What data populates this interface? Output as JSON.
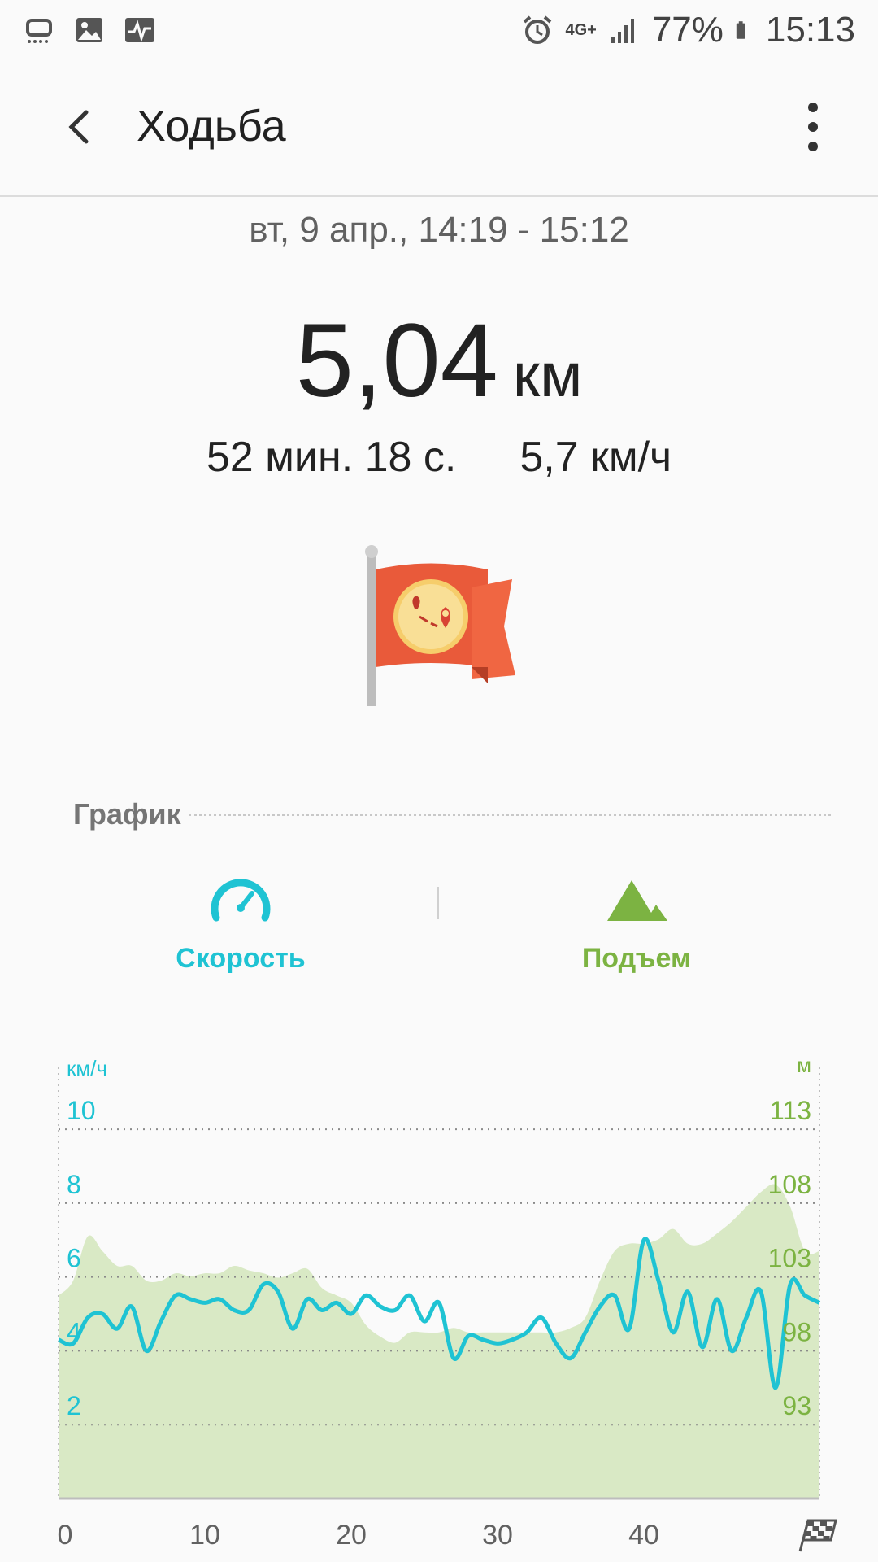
{
  "status_bar": {
    "battery": "77%",
    "time": "15:13",
    "network": "4G+",
    "icons": [
      "notification-icon",
      "gallery-icon",
      "activity-icon",
      "alarm-icon",
      "signal-icon",
      "battery-icon"
    ]
  },
  "appbar": {
    "title": "Ходьба",
    "back_icon": "back-arrow-icon",
    "menu_icon": "more-vert-icon"
  },
  "workout": {
    "date": "вт, 9 апр., 14:19 - 15:12",
    "distance_value": "5,04",
    "distance_unit": "км",
    "duration": "52 мин. 18 с.",
    "avg_speed": "5,7 км/ч",
    "badge_icon": "route-flag-icon"
  },
  "graph": {
    "section_title": "График",
    "tabs": [
      {
        "label": "Скорость",
        "icon": "speedometer-icon",
        "color": "#1fc3d3"
      },
      {
        "label": "Подъем",
        "icon": "mountain-icon",
        "color": "#7cb342"
      }
    ]
  },
  "chart_data": {
    "type": "line",
    "left_axis_unit": "км/ч",
    "right_axis_unit": "м",
    "left_ticks": [
      "10",
      "8",
      "6",
      "4",
      "2"
    ],
    "right_ticks": [
      "113",
      "108",
      "103",
      "98",
      "93"
    ],
    "x_ticks": [
      "0",
      "10",
      "20",
      "30",
      "40"
    ],
    "finish_icon": "checkered-flag-icon",
    "xlim": [
      0,
      52
    ],
    "y_left_lim": [
      0,
      11.5
    ],
    "y_right_lim": [
      86.25,
      115
    ],
    "series": [
      {
        "axis": "left",
        "color": "#1fc3d3",
        "type": "line",
        "x": [
          0,
          1,
          2,
          3,
          4,
          5,
          6,
          7,
          8,
          9,
          10,
          11,
          12,
          13,
          14,
          15,
          16,
          17,
          18,
          19,
          20,
          21,
          22,
          23,
          24,
          25,
          26,
          27,
          28,
          29,
          30,
          31,
          32,
          33,
          34,
          35,
          36,
          37,
          38,
          39,
          40,
          41,
          42,
          43,
          44,
          45,
          46,
          47,
          48,
          49,
          50,
          51,
          52
        ],
        "values": [
          4.3,
          4.2,
          4.9,
          5.0,
          4.6,
          5.2,
          4.0,
          4.8,
          5.5,
          5.4,
          5.3,
          5.4,
          5.1,
          5.1,
          5.8,
          5.6,
          4.6,
          5.4,
          5.1,
          5.3,
          5.0,
          5.5,
          5.2,
          5.1,
          5.5,
          4.8,
          5.3,
          3.8,
          4.4,
          4.3,
          4.2,
          4.3,
          4.5,
          4.9,
          4.2,
          3.8,
          4.5,
          5.2,
          5.5,
          4.6,
          7.0,
          5.9,
          4.5,
          5.6,
          4.1,
          5.4,
          4.0,
          4.9,
          5.6,
          3.0,
          5.8,
          5.5,
          5.3
        ]
      },
      {
        "axis": "right",
        "color": "#d9e9c5",
        "type": "area",
        "x": [
          0,
          1,
          2,
          3,
          4,
          5,
          6,
          7,
          8,
          9,
          10,
          11,
          12,
          13,
          14,
          15,
          16,
          17,
          18,
          19,
          20,
          21,
          22,
          23,
          24,
          25,
          26,
          27,
          28,
          29,
          30,
          31,
          32,
          33,
          34,
          35,
          36,
          37,
          38,
          39,
          40,
          41,
          42,
          43,
          44,
          45,
          46,
          47,
          48,
          49,
          50,
          51,
          52
        ],
        "values": [
          100,
          101,
          104,
          103,
          102,
          102,
          101,
          101,
          101.5,
          101.3,
          101.5,
          101.5,
          102,
          101.7,
          101.5,
          101.2,
          101.5,
          101.8,
          100.5,
          100,
          99.5,
          98,
          97.2,
          96.8,
          97.5,
          97.5,
          97.5,
          97.8,
          97.5,
          97.5,
          97.5,
          97.5,
          97.5,
          97.5,
          97.5,
          97.8,
          98.5,
          101,
          103,
          103.5,
          103.5,
          103.8,
          104.5,
          103.5,
          103.5,
          104.2,
          105,
          106,
          107,
          107.5,
          106,
          103,
          103
        ]
      }
    ]
  }
}
